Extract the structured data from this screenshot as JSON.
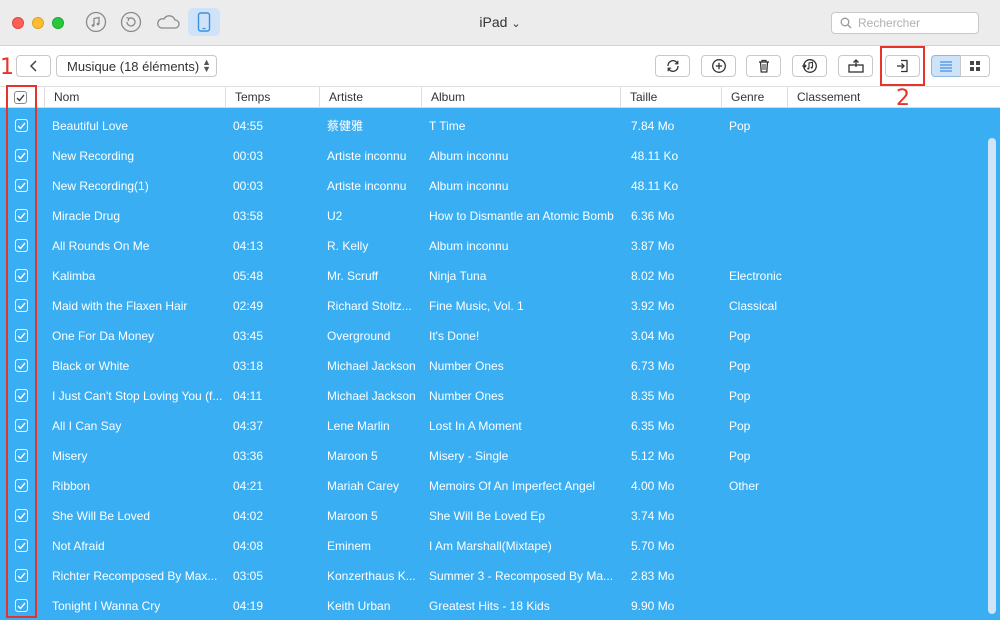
{
  "window": {
    "title": "iPad",
    "title_caret": "⌄"
  },
  "toolbar_icons": [
    "music-icon",
    "restore-icon",
    "cloud-icon",
    "ipad-device-icon"
  ],
  "search": {
    "placeholder": "Rechercher"
  },
  "category_select": {
    "value": "Musique (18 éléments)"
  },
  "actions": [
    "refresh-icon",
    "add-icon",
    "delete-icon",
    "to-itunes-icon",
    "to-computer-icon",
    "export-to-device-icon"
  ],
  "annotations": {
    "first": "1",
    "second": "2"
  },
  "colors": {
    "selection": "#39aef3",
    "annotation": "#e8332a",
    "active_view": "#cfe3f8"
  },
  "columns": {
    "name": "Nom",
    "time": "Temps",
    "artist": "Artiste",
    "album": "Album",
    "size": "Taille",
    "genre": "Genre",
    "rating": "Classement"
  },
  "rows": [
    {
      "name": "Beautiful Love",
      "time": "04:55",
      "artist": "蔡健雅",
      "album": "T Time",
      "size": "7.84 Mo",
      "genre": "Pop"
    },
    {
      "name": "New Recording",
      "time": "00:03",
      "artist": "Artiste inconnu",
      "album": "Album inconnu",
      "size": "48.11 Ko",
      "genre": ""
    },
    {
      "name": "New Recording(1)",
      "time": "00:03",
      "artist": "Artiste inconnu",
      "album": "Album inconnu",
      "size": "48.11 Ko",
      "genre": ""
    },
    {
      "name": "Miracle Drug",
      "time": "03:58",
      "artist": "U2",
      "album": "How to Dismantle an Atomic Bomb",
      "size": "6.36 Mo",
      "genre": ""
    },
    {
      "name": "All Rounds On Me",
      "time": "04:13",
      "artist": "R. Kelly",
      "album": "Album inconnu",
      "size": "3.87 Mo",
      "genre": ""
    },
    {
      "name": "Kalimba",
      "time": "05:48",
      "artist": "Mr. Scruff",
      "album": "Ninja Tuna",
      "size": "8.02 Mo",
      "genre": "Electronic"
    },
    {
      "name": "Maid with the Flaxen Hair",
      "time": "02:49",
      "artist": "Richard Stoltz...",
      "album": "Fine Music, Vol. 1",
      "size": "3.92 Mo",
      "genre": "Classical"
    },
    {
      "name": "One For Da Money",
      "time": "03:45",
      "artist": "Overground",
      "album": "It's Done!",
      "size": "3.04 Mo",
      "genre": "Pop"
    },
    {
      "name": "Black or White",
      "time": "03:18",
      "artist": "Michael Jackson",
      "album": "Number Ones",
      "size": "6.73 Mo",
      "genre": "Pop"
    },
    {
      "name": "I Just Can't Stop Loving You (f...",
      "time": "04:11",
      "artist": "Michael Jackson",
      "album": "Number Ones",
      "size": "8.35 Mo",
      "genre": "Pop"
    },
    {
      "name": "All I Can Say",
      "time": "04:37",
      "artist": "Lene Marlin",
      "album": "Lost In A Moment",
      "size": "6.35 Mo",
      "genre": "Pop"
    },
    {
      "name": "Misery",
      "time": "03:36",
      "artist": "Maroon 5",
      "album": "Misery - Single",
      "size": "5.12 Mo",
      "genre": "Pop"
    },
    {
      "name": "Ribbon",
      "time": "04:21",
      "artist": "Mariah Carey",
      "album": "Memoirs Of An Imperfect Angel",
      "size": "4.00 Mo",
      "genre": "Other"
    },
    {
      "name": "She Will Be Loved",
      "time": "04:02",
      "artist": "Maroon 5",
      "album": "She Will Be Loved Ep",
      "size": "3.74 Mo",
      "genre": ""
    },
    {
      "name": "Not Afraid",
      "time": "04:08",
      "artist": "Eminem",
      "album": "I Am Marshall(Mixtape)",
      "size": "5.70 Mo",
      "genre": ""
    },
    {
      "name": "Richter Recomposed By Max...",
      "time": "03:05",
      "artist": "Konzerthaus K...",
      "album": "Summer 3 - Recomposed By Ma...",
      "size": "2.83 Mo",
      "genre": ""
    },
    {
      "name": "Tonight I Wanna Cry",
      "time": "04:19",
      "artist": "Keith Urban",
      "album": "Greatest Hits - 18 Kids",
      "size": "9.90 Mo",
      "genre": ""
    }
  ]
}
